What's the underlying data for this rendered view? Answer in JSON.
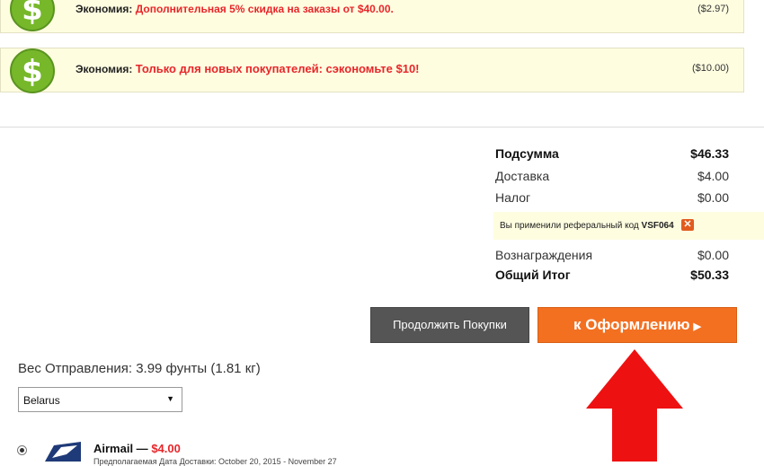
{
  "promos": [
    {
      "prefix": "Экономия:",
      "highlight": "Дополнительная 5% скидка на заказы от $40.00.",
      "amount": "($2.97)"
    },
    {
      "prefix": "Экономия:",
      "highlight": "Только для новых покупателей: сэкономьте $10!",
      "amount": "($10.00)"
    }
  ],
  "summary": {
    "subtotal_label": "Подсумма",
    "subtotal_value": "$46.33",
    "shipping_label": "Доставка",
    "shipping_value": "$4.00",
    "tax_label": "Налог",
    "tax_value": "$0.00",
    "rewards_label": "Вознаграждения",
    "rewards_value": "$0.00",
    "total_label": "Общий Итог",
    "total_value": "$50.33"
  },
  "referral": {
    "text": "Вы применили реферальный код",
    "code": "VSF064",
    "remove_glyph": "✕"
  },
  "buttons": {
    "continue_label": "Продолжить Покупки",
    "checkout_label": "к Оформлению",
    "checkout_caret": "▶"
  },
  "shipping": {
    "weight_text": "Вес Отправления: 3.99 фунты (1.81 кг)",
    "country_value": "Belarus",
    "method_name": "Airmail —",
    "method_price": "$4.00",
    "eta_text": "Предполагаемая Дата Доставки: October 20, 2015 - November 27"
  },
  "colors": {
    "accent_red": "#e8262a",
    "checkout_orange": "#f37021",
    "promo_bg": "#fefde0",
    "dollar_green": "#76b82a"
  },
  "icons": [
    "dollar-coin-icon",
    "remove-x-icon",
    "chevron-right-icon",
    "chevron-down-icon",
    "usps-eagle-icon",
    "red-up-arrow"
  ]
}
